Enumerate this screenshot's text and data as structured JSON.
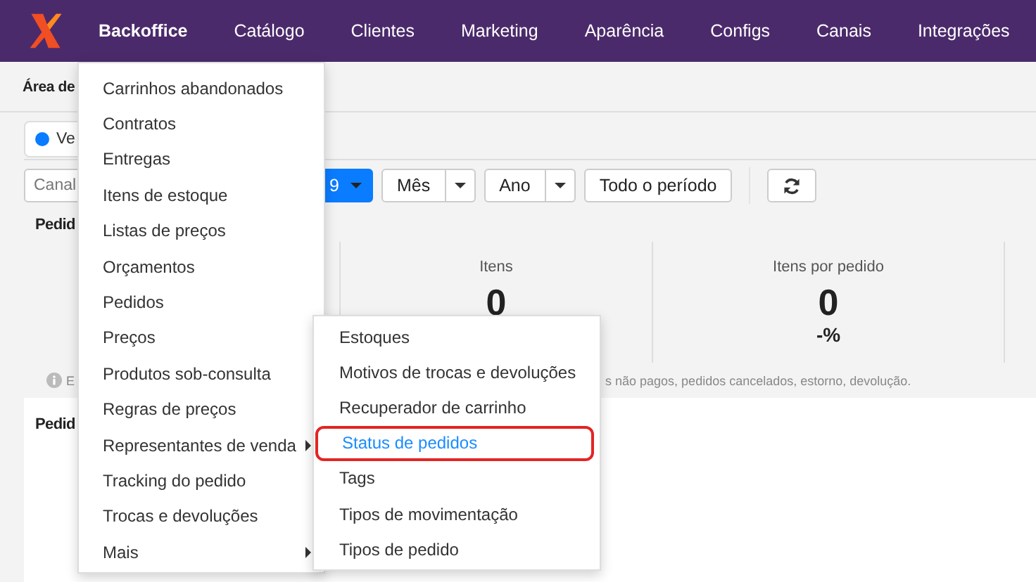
{
  "nav": [
    {
      "label": "Backoffice",
      "selected": true
    },
    {
      "label": "Catálogo",
      "selected": false
    },
    {
      "label": "Clientes",
      "selected": false
    },
    {
      "label": "Marketing",
      "selected": false
    },
    {
      "label": "Aparência",
      "selected": false
    },
    {
      "label": "Configs",
      "selected": false
    },
    {
      "label": "Canais",
      "selected": false
    },
    {
      "label": "Integrações",
      "selected": false
    }
  ],
  "page_title": "Área de",
  "view_chip": {
    "label": "Ve",
    "selected": true
  },
  "filters": {
    "channel_placeholder": "Canal",
    "active_button": "9",
    "month": "Mês",
    "year": "Ano",
    "all_period": "Todo o período"
  },
  "section_title": "Pedid",
  "stats": [
    {
      "label": "Itens",
      "value": "0"
    },
    {
      "label": "Itens por pedido",
      "value": "0",
      "change": "-%"
    }
  ],
  "note": {
    "lead": "E",
    "text": "s não pagos, pedidos cancelados, estorno, devolução."
  },
  "card_title": "Pedid",
  "menu": [
    {
      "label": "Carrinhos abandonados",
      "submenu": false
    },
    {
      "label": "Contratos",
      "submenu": false
    },
    {
      "label": "Entregas",
      "submenu": false
    },
    {
      "label": "Itens de estoque",
      "submenu": false
    },
    {
      "label": "Listas de preços",
      "submenu": false
    },
    {
      "label": "Orçamentos",
      "submenu": false
    },
    {
      "label": "Pedidos",
      "submenu": false
    },
    {
      "label": "Preços",
      "submenu": false
    },
    {
      "label": "Produtos sob-consulta",
      "submenu": false
    },
    {
      "label": "Regras de preços",
      "submenu": false
    },
    {
      "label": "Representantes de venda",
      "submenu": true
    },
    {
      "label": "Tracking do pedido",
      "submenu": false
    },
    {
      "label": "Trocas e devoluções",
      "submenu": false
    },
    {
      "label": "Mais",
      "submenu": true
    }
  ],
  "submenu": [
    {
      "label": "Estoques",
      "selected": false
    },
    {
      "label": "Motivos de trocas e devoluções",
      "selected": false
    },
    {
      "label": "Recuperador de carrinho",
      "selected": false
    },
    {
      "label": "Status de pedidos",
      "selected": true
    },
    {
      "label": "Tags",
      "selected": false
    },
    {
      "label": "Tipos de movimentação",
      "selected": false
    },
    {
      "label": "Tipos de pedido",
      "selected": false
    }
  ]
}
